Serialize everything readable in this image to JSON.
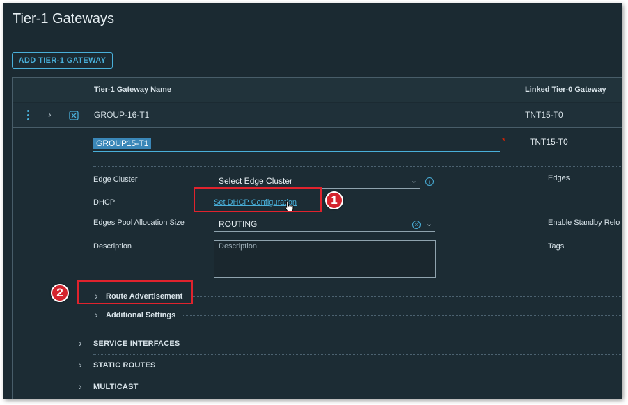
{
  "page": {
    "title": "Tier-1 Gateways"
  },
  "toolbar": {
    "add_label": "ADD TIER-1 GATEWAY"
  },
  "table": {
    "columns": {
      "name": "Tier-1 Gateway Name",
      "linked": "Linked Tier-0 Gateway"
    },
    "row": {
      "name": "GROUP-16-T1",
      "linked": "TNT15-T0"
    }
  },
  "form": {
    "name_value": "GROUP15-T1",
    "tier0_value": "TNT15-T0",
    "edge_cluster": {
      "label": "Edge Cluster",
      "value": "Select Edge Cluster"
    },
    "dhcp": {
      "label": "DHCP",
      "link": "Set DHCP Configuration"
    },
    "pool": {
      "label": "Edges Pool Allocation Size",
      "value": "ROUTING"
    },
    "description": {
      "label": "Description",
      "placeholder": "Description"
    },
    "right_labels": {
      "edges": "Edges",
      "standby": "Enable Standby Relo",
      "tags": "Tags"
    },
    "route_advertisement": "Route Advertisement",
    "additional_settings": "Additional Settings"
  },
  "sections": {
    "service_interfaces": "SERVICE INTERFACES",
    "static_routes": "STATIC ROUTES",
    "multicast": "MULTICAST"
  },
  "annotations": {
    "callout_1": "1",
    "callout_2": "2"
  },
  "colors": {
    "accent": "#49afd9",
    "callout": "#d4242e",
    "background": "#1b2a32"
  },
  "icons": [
    "kebab-menu-icon",
    "chevron-right-icon",
    "gateway-icon",
    "info-icon",
    "clear-icon",
    "chevron-down-icon",
    "hand-cursor-icon"
  ]
}
